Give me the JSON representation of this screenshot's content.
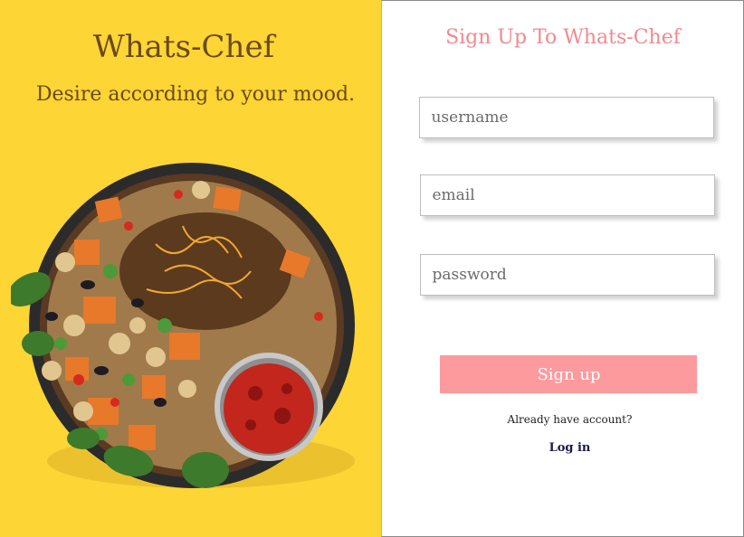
{
  "left_panel": {
    "brand_title": "Whats-Chef",
    "tagline": "Desire according to your mood.",
    "background_color": "#fdd535",
    "image": "food-bowl-image"
  },
  "signup_form": {
    "title": "Sign Up To Whats-Chef",
    "username_placeholder": "username",
    "email_placeholder": "email",
    "password_placeholder": "password",
    "submit_label": "Sign up",
    "already_text": "Already have account?",
    "login_label": "Log in",
    "accent_color": "#fd9a9e"
  }
}
